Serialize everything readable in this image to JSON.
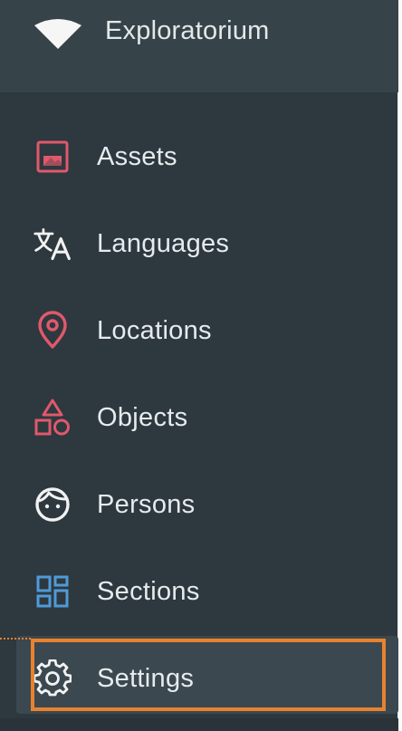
{
  "app": {
    "title": "Exploratorium"
  },
  "sidebar": {
    "items": [
      {
        "label": "Assets",
        "icon": "image-icon",
        "color": "#e0596b"
      },
      {
        "label": "Languages",
        "icon": "translate-icon",
        "color": "#f2f2f2"
      },
      {
        "label": "Locations",
        "icon": "map-pin-icon",
        "color": "#e0596b"
      },
      {
        "label": "Objects",
        "icon": "shapes-icon",
        "color": "#e0596b"
      },
      {
        "label": "Persons",
        "icon": "face-icon",
        "color": "#f2f2f2"
      },
      {
        "label": "Sections",
        "icon": "dashboard-icon",
        "color": "#4f9bd8"
      },
      {
        "label": "Settings",
        "icon": "gear-icon",
        "color": "#f2f2f2"
      }
    ],
    "active_item": "Settings"
  },
  "colors": {
    "panel": "#2d383f",
    "header": "#364349",
    "highlight": "#e8822e",
    "text": "#e6ebed"
  }
}
